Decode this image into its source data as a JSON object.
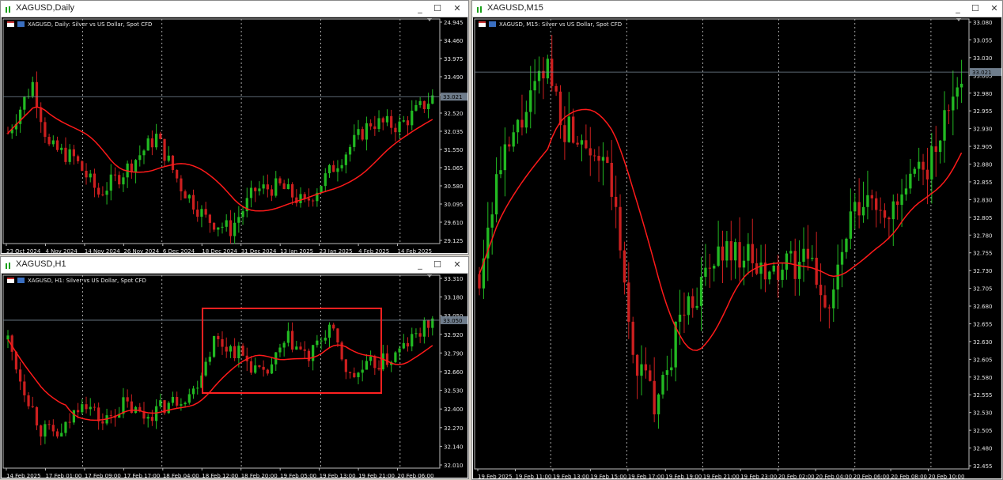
{
  "windows": {
    "daily": {
      "title": "XAGUSD,Daily",
      "symbol_info": "XAGUSD, Daily:  Silver vs US Dollar, Spot CFD",
      "price_tag": "33.021",
      "price_ticks": [
        "24.945",
        "34.460",
        "33.975",
        "33.490",
        "33.005",
        "32.520",
        "32.035",
        "31.550",
        "31.065",
        "30.580",
        "30.095",
        "29.610",
        "29.125"
      ],
      "time_ticks": [
        "23 Oct 2024",
        "4 Nov 2024",
        "14 Nov 2024",
        "26 Nov 2024",
        "6 Dec 2024",
        "18 Dec 2024",
        "31 Dec 2024",
        "13 Jan 2025",
        "23 Jan 2025",
        "4 Feb 2025",
        "14 Feb 2025"
      ]
    },
    "h1": {
      "title": "XAGUSD,H1",
      "symbol_info": "XAGUSD, H1:  Silver vs US Dollar, Spot CFD",
      "price_tag": "33.050",
      "price_ticks": [
        "33.310",
        "33.180",
        "33.050",
        "32.920",
        "32.790",
        "32.660",
        "32.530",
        "32.400",
        "32.270",
        "32.140",
        "32.010"
      ],
      "time_ticks": [
        "14 Feb 2025",
        "17 Feb 01:00",
        "17 Feb 09:00",
        "17 Feb 17:00",
        "18 Feb 04:00",
        "18 Feb 12:00",
        "18 Feb 20:00",
        "19 Feb 05:00",
        "19 Feb 13:00",
        "19 Feb 21:00",
        "20 Feb 06:00"
      ]
    },
    "m15": {
      "title": "XAGUSD,M15",
      "symbol_info": "XAGUSD, M15:  Silver vs US Dollar, Spot CFD",
      "price_tag": "33.021",
      "price_ticks": [
        "33.080",
        "33.055",
        "33.030",
        "33.005",
        "32.980",
        "32.955",
        "32.930",
        "32.905",
        "32.880",
        "32.855",
        "32.830",
        "32.805",
        "32.780",
        "32.755",
        "32.730",
        "32.705",
        "32.680",
        "32.655",
        "32.630",
        "32.605",
        "32.580",
        "32.555",
        "32.530",
        "32.505",
        "32.480",
        "32.455"
      ],
      "time_ticks": [
        "19 Feb 2025",
        "19 Feb 11:00",
        "19 Feb 13:00",
        "19 Feb 15:00",
        "19 Feb 17:00",
        "19 Feb 19:00",
        "19 Feb 21:00",
        "19 Feb 23:00",
        "20 Feb 02:00",
        "20 Feb 04:00",
        "20 Feb 06:00",
        "20 Feb 08:00",
        "20 Feb 10:00"
      ]
    }
  },
  "window_buttons": {
    "minimize": "_",
    "maximize": "☐",
    "close": "✕"
  },
  "icons": {
    "window": "chart-window-icon",
    "flag": "flag-icon",
    "symbol": "symbol-icon"
  },
  "colors": {
    "bull": "#22b922",
    "bear": "#cc1f1f",
    "ma": "#ff1a1a",
    "box": "#ff2020",
    "text": "#e6e6e6",
    "grid": "#cfcfcf"
  },
  "chart_data": [
    {
      "type": "candlestick",
      "title": "XAGUSD,Daily",
      "ylim": [
        28.9,
        35.2
      ],
      "indicator": "moving average",
      "anchors": [
        [
          0,
          32.0
        ],
        [
          6,
          33.4
        ],
        [
          10,
          31.6
        ],
        [
          16,
          31.3
        ],
        [
          22,
          30.3
        ],
        [
          28,
          30.9
        ],
        [
          36,
          31.9
        ],
        [
          42,
          30.5
        ],
        [
          48,
          29.6
        ],
        [
          54,
          29.3
        ],
        [
          60,
          30.4
        ],
        [
          66,
          30.5
        ],
        [
          72,
          30.0
        ],
        [
          80,
          31.2
        ],
        [
          88,
          32.3
        ],
        [
          95,
          32.2
        ],
        [
          103,
          33.0
        ]
      ]
    },
    {
      "type": "candlestick",
      "title": "XAGUSD,H1",
      "ylim": [
        31.9,
        33.4
      ],
      "indicator": "moving average",
      "highlight_box": true,
      "anchors": [
        [
          0,
          32.9
        ],
        [
          3,
          32.6
        ],
        [
          8,
          32.2
        ],
        [
          13,
          32.15
        ],
        [
          18,
          32.45
        ],
        [
          23,
          32.25
        ],
        [
          28,
          32.4
        ],
        [
          33,
          32.3
        ],
        [
          39,
          32.4
        ],
        [
          45,
          32.5
        ],
        [
          50,
          32.9
        ],
        [
          56,
          32.8
        ],
        [
          62,
          32.6
        ],
        [
          68,
          32.9
        ],
        [
          73,
          32.75
        ],
        [
          78,
          33.0
        ],
        [
          83,
          32.6
        ],
        [
          88,
          32.7
        ],
        [
          93,
          32.75
        ],
        [
          98,
          32.9
        ],
        [
          103,
          33.05
        ]
      ]
    },
    {
      "type": "candlestick",
      "title": "XAGUSD,M15",
      "ylim": [
        32.43,
        33.1
      ],
      "indicator": "moving average",
      "anchors": [
        [
          0,
          32.72
        ],
        [
          4,
          32.86
        ],
        [
          10,
          32.95
        ],
        [
          16,
          33.03
        ],
        [
          20,
          32.94
        ],
        [
          26,
          32.92
        ],
        [
          31,
          32.85
        ],
        [
          36,
          32.6
        ],
        [
          42,
          32.52
        ],
        [
          47,
          32.66
        ],
        [
          52,
          32.7
        ],
        [
          57,
          32.76
        ],
        [
          62,
          32.75
        ],
        [
          67,
          32.71
        ],
        [
          72,
          32.73
        ],
        [
          77,
          32.74
        ],
        [
          82,
          32.67
        ],
        [
          87,
          32.8
        ],
        [
          92,
          32.83
        ],
        [
          97,
          32.81
        ],
        [
          102,
          32.86
        ],
        [
          107,
          32.9
        ],
        [
          112,
          33.02
        ]
      ]
    }
  ]
}
